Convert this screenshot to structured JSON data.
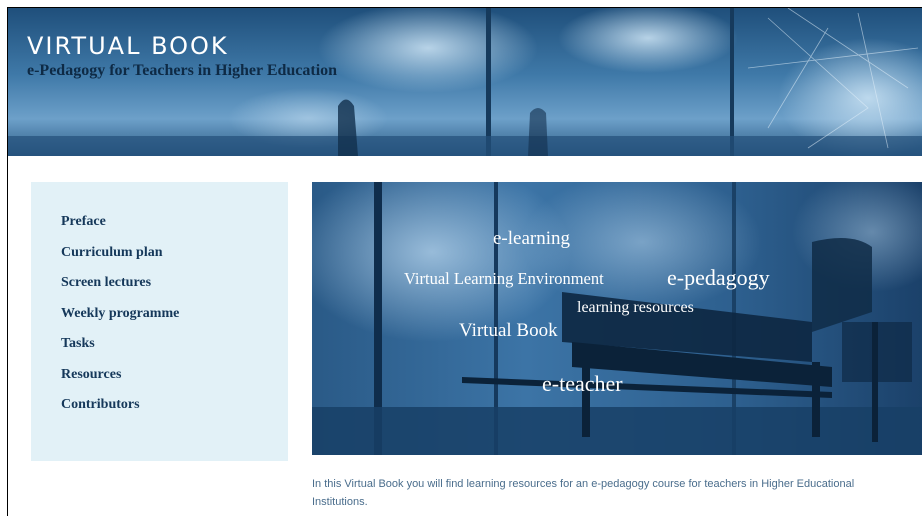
{
  "header": {
    "title": "VIRTUAL BOOK",
    "subtitle": "e-Pedagogy for Teachers in Higher Education"
  },
  "nav": [
    {
      "label": "Preface"
    },
    {
      "label": "Curriculum plan"
    },
    {
      "label": "Screen lectures"
    },
    {
      "label": "Weekly programme"
    },
    {
      "label": "Tasks"
    },
    {
      "label": "Resources"
    },
    {
      "label": "Contributors"
    }
  ],
  "hero": {
    "tags": [
      "e-learning",
      "Virtual Learning Environment",
      "e-pedagogy",
      "learning resources",
      "Virtual Book",
      "e-teacher"
    ]
  },
  "intro": {
    "line1": "In this Virtual Book you will find learning resources for an e-pedagogy course for teachers in Higher Educational",
    "line2": "Institutions."
  },
  "colors": {
    "banner": "#3d76a6",
    "sidebar_bg": "#e2f1f7",
    "nav_text": "#15385a",
    "intro_text": "#4a6d8c"
  }
}
